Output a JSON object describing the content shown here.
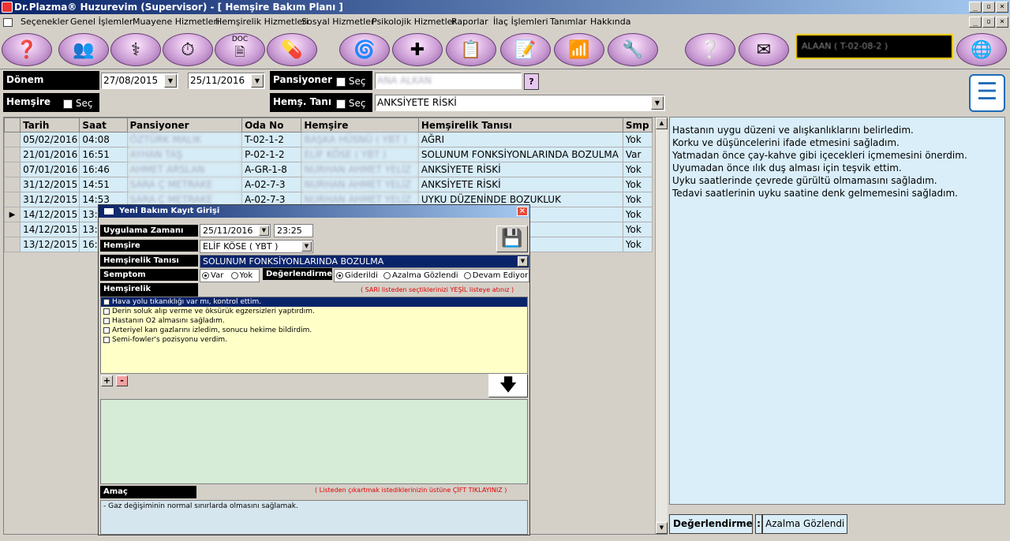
{
  "window": {
    "title": "Dr.Plazma® Huzurevim (Supervisor) - [ Hemşire Bakım Planı ]",
    "controls": [
      "_",
      "▫",
      "×"
    ]
  },
  "menu": [
    "Seçenekler",
    "Genel İşlemler",
    "Muayene Hizmetleri",
    "Hemşirelik Hizmetleri",
    "Sosyal Hizmetler",
    "Psikolojik Hizmetler",
    "Raporlar",
    "İlaç İşlemleri",
    "Tanımlar",
    "Hakkında"
  ],
  "toolbar": {
    "icons": [
      "help-head-icon",
      "doctors-icon",
      "stethoscope-icon",
      "stopwatch-icon",
      "doc-icon",
      "pills-icon",
      "spiral-icon",
      "bandage-icon",
      "clipboard-icon",
      "checklist-icon",
      "chart-icon",
      "tools-icon",
      "question-note-icon",
      "mail-icon",
      "globe-icon"
    ],
    "doc_label": "DOC",
    "user": "ALAAN ( T-02-08-2 )"
  },
  "filters": {
    "period_label": "Dönem",
    "date_from": "27/08/2015",
    "date_to": "25/11/2016",
    "resident_label": "Pansiyoner",
    "resident_sec": "Seç",
    "resident_value": "ANA ALKAN",
    "help_button": "?",
    "nurse_label": "Hemşire",
    "nurse_sec": "Seç",
    "diag_label": "Hemş. Tanı",
    "diag_sec": "Seç",
    "diag_value": "ANKSİYETE RİSKİ"
  },
  "grid": {
    "headers": [
      "Tarih",
      "Saat",
      "Pansiyoner",
      "Oda No",
      "Hemşire",
      "Hemşirelik Tanısı",
      "Smp"
    ],
    "rows": [
      {
        "date": "05/02/2016",
        "time": "04:08",
        "resident": "ÖZTÜRK MALIK",
        "room": "T-02-1-2",
        "nurse": "BAŞKA HÜSNÜ ( YBT )",
        "diag": "AĞRI",
        "smp": "Yok"
      },
      {
        "date": "21/01/2016",
        "time": "16:51",
        "resident": "AYHAN TAŞ",
        "room": "P-02-1-2",
        "nurse": "ELİF KÖSE ( YBT )",
        "diag": "SOLUNUM FONKSİYONLARINDA BOZULMA",
        "smp": "Var"
      },
      {
        "date": "07/01/2016",
        "time": "16:46",
        "resident": "AHMET ARSLAN",
        "room": "A-GR-1-8",
        "nurse": "NURHAN AHMET YELİZ",
        "diag": "ANKSİYETE RİSKİ",
        "smp": "Yok"
      },
      {
        "date": "31/12/2015",
        "time": "14:51",
        "resident": "SARA Ç METRAKE",
        "room": "A-02-7-3",
        "nurse": "NURHAN AHMET YELİZ",
        "diag": "ANKSİYETE RİSKİ",
        "smp": "Yok"
      },
      {
        "date": "31/12/2015",
        "time": "14:53",
        "resident": "SARA Ç METRAKE",
        "room": "A-02-7-3",
        "nurse": "NURHAN AHMET YELİZ",
        "diag": "UYKU DÜZENİNDE BOZUKLUK",
        "smp": "Yok"
      },
      {
        "date": "14/12/2015",
        "time": "13:3",
        "resident": "",
        "room": "",
        "nurse": "",
        "diag": "KLUK",
        "smp": "Yok"
      },
      {
        "date": "14/12/2015",
        "time": "13:3",
        "resident": "",
        "room": "",
        "nurse": "",
        "diag": "KLUK",
        "smp": "Yok"
      },
      {
        "date": "13/12/2015",
        "time": "16:1",
        "resident": "",
        "room": "",
        "nurse": "",
        "diag": "ARINDA BOZULMA",
        "smp": "Yok"
      }
    ]
  },
  "right_panel": {
    "lines": [
      "Hastanın uygu düzeni ve alışkanlıklarını belirledim.",
      "Korku ve düşüncelerini ifade etmesini sağladım.",
      "Yatmadan önce çay-kahve gibi içecekleri içmemesini önerdim.",
      "Uyumadan önce ılık duş alması için teşvik ettim.",
      "Uyku saatlerinde çevrede gürültü olmamasını sağladım.",
      "Tedavi saatlerinin uyku saatine denk gelmemesini sağladım."
    ],
    "eval_label": "Değerlendirme",
    "eval_sep": ":",
    "eval_value": "Azalma Gözlendi"
  },
  "dialog": {
    "title": "Yeni Bakım Kayıt Girişi",
    "close": "×",
    "app_time_label": "Uygulama Zamanı",
    "date": "25/11/2016",
    "time": "23:25",
    "nurse_label": "Hemşire",
    "nurse_value": "ELİF KÖSE ( YBT )",
    "diag_label": "Hemşirelik Tanısı",
    "diag_value": "SOLUNUM FONKSİYONLARINDA BOZULMA",
    "symptom_label": "Semptom",
    "symptom_var": "Var",
    "symptom_yok": "Yok",
    "eval_label": "Değerlendirme",
    "eval_opt1": "Giderildi",
    "eval_opt2": "Azalma Gözlendi",
    "eval_opt3": "Devam Ediyor",
    "interventions_label": "Hemşirelik Girişimleri",
    "hint_yellow": "( SARI listeden seçtiklerinizi YEŞİL listeye atınız )",
    "interventions": [
      "Hava yolu tıkanıklığı var mı, kontrol ettim.",
      "Derin soluk alıp verme ve öksürük egzersizleri yaptırdım.",
      "Hastanın O2 almasını sağladım.",
      "Arteriyel kan gazlarını izledim, sonucu hekime bildirdim.",
      "Semi-fowler's pozisyonu verdim."
    ],
    "plus": "+",
    "minus": "-",
    "move_down": "🡇",
    "goal_label": "Amaç",
    "hint_remove": "( Listeden çıkartmak istediklerinizin üstüne ÇİFT TIKLAYINIZ )",
    "goal_text": "- Gaz değişiminin normal sınırlarda olmasını sağlamak."
  }
}
